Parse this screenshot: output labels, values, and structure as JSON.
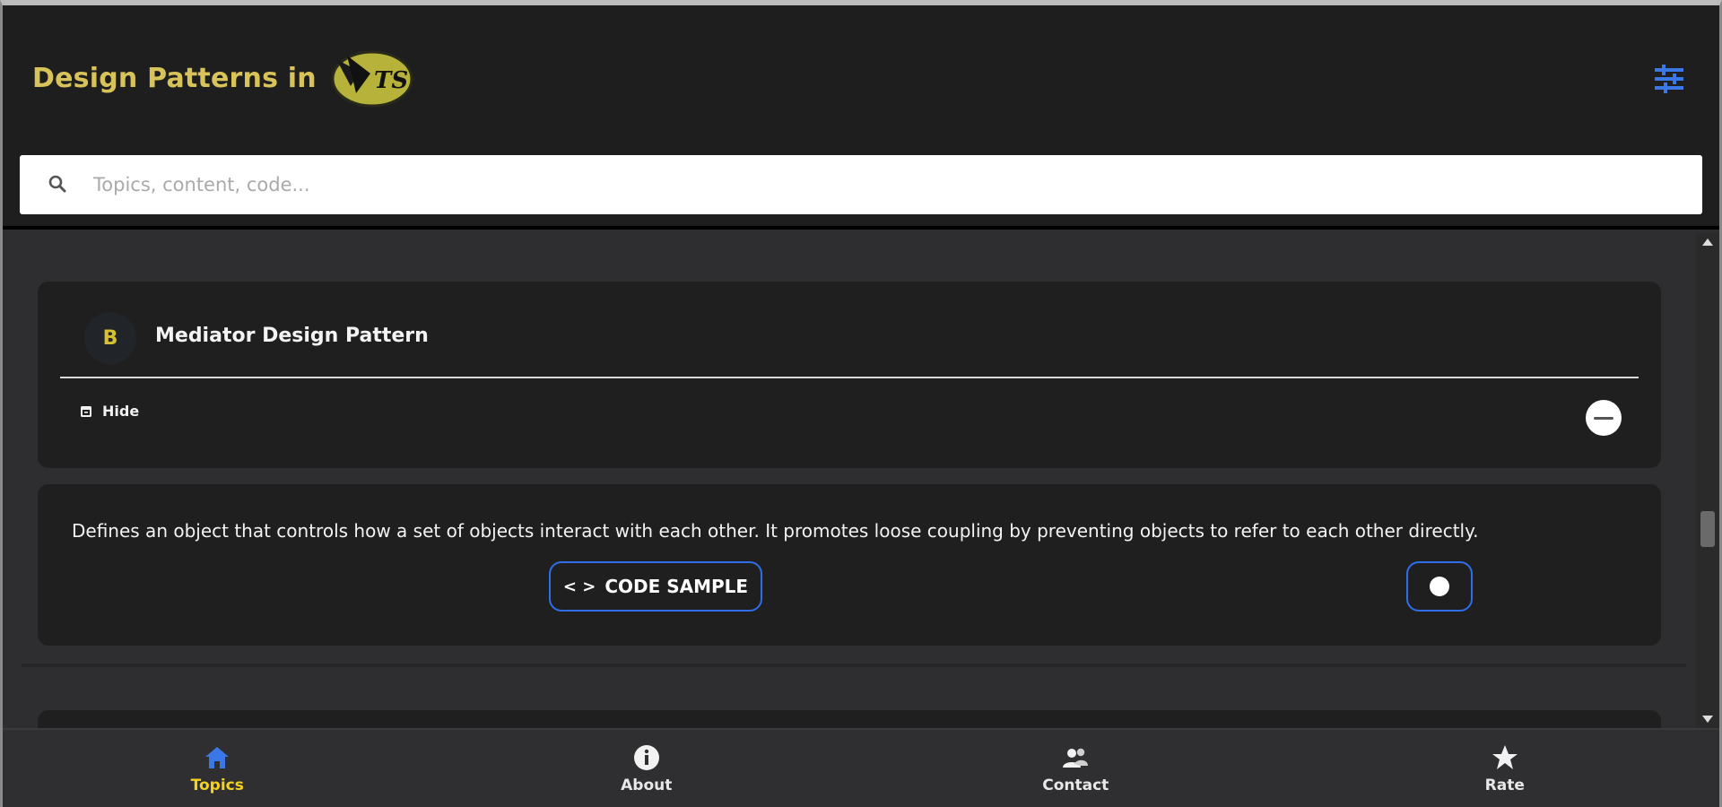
{
  "header": {
    "title": "Design Patterns in",
    "logo_text": "TS",
    "settings_icon": "sliders-icon"
  },
  "search": {
    "placeholder": "Topics, content, code...",
    "value": ""
  },
  "pattern": {
    "avatar_letter": "B",
    "title": "Mediator Design Pattern",
    "hide_label": "Hide",
    "description": "Defines an object that controls how a set of objects interact with each other. It promotes loose coupling by preventing objects to refer to each other directly.",
    "code_sample_label": "CODE SAMPLE",
    "code_icon": "< >"
  },
  "nav": {
    "items": [
      {
        "label": "Topics",
        "icon": "home-icon",
        "active": true
      },
      {
        "label": "About",
        "icon": "info-icon",
        "active": false
      },
      {
        "label": "Contact",
        "icon": "contacts-icon",
        "active": false
      },
      {
        "label": "Rate",
        "icon": "star-icon",
        "active": false
      }
    ]
  },
  "colors": {
    "accent_blue": "#2f6ee8",
    "brand_yellow": "#d8c35a",
    "active_tab": "#f5d21e"
  }
}
